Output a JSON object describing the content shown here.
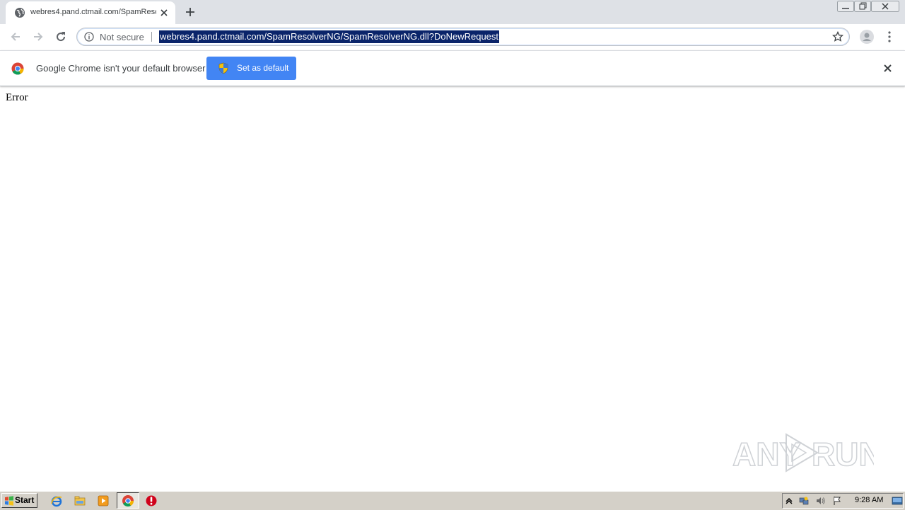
{
  "browser": {
    "tab_title": "webres4.pand.ctmail.com/SpamReso",
    "security_label": "Not secure",
    "url": "webres4.pand.ctmail.com/SpamResolverNG/SpamResolverNG.dll?DoNewRequest"
  },
  "infobar": {
    "message": "Google Chrome isn't your default browser",
    "button_label": "Set as default"
  },
  "page": {
    "content_text": "Error"
  },
  "watermark": {
    "text_left": "ANY",
    "text_right": "RUN"
  },
  "taskbar": {
    "start_label": "Start",
    "clock": "9:28 AM",
    "apps": [
      "internet-explorer-icon",
      "file-explorer-icon",
      "media-player-icon",
      "chrome-icon",
      "antivirus-icon"
    ]
  },
  "colors": {
    "tabstrip": "#dee1e6",
    "accent": "#4285f4",
    "url_highlight": "#0a246a",
    "taskbar": "#d4d0c8"
  }
}
